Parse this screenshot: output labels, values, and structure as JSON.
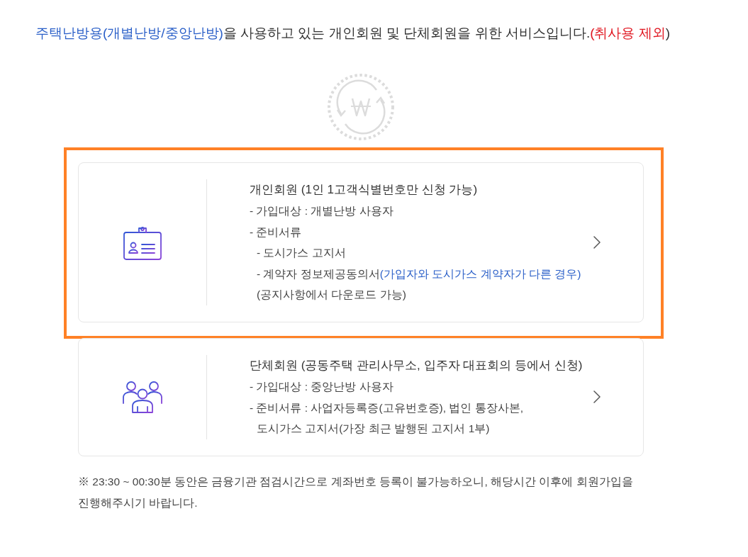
{
  "intro": {
    "segments": [
      {
        "kind": "highlight",
        "text": "주택난방용(개별난방/중앙난방)"
      },
      {
        "kind": "plain",
        "text": "을 사용하고 있는 개인회원 및 단체회원을 위한 서비스입니다."
      },
      {
        "kind": "warning",
        "text": "(취사용 제외"
      },
      {
        "kind": "plain",
        "text": ")"
      }
    ]
  },
  "cards": [
    {
      "kind": "individual",
      "selected": true,
      "title": "개인회원 (1인 1고객식별번호만 신청 가능)",
      "items": [
        {
          "text": "- 가입대상 : 개별난방 사용자"
        },
        {
          "text": "- 준비서류",
          "children": [
            {
              "text": "- 도시가스 고지서"
            },
            {
              "text": "- 계약자 정보제공동의서",
              "note": "(가입자와 도시가스 계약자가 다른 경우)"
            },
            {
              "text": "(공지사항에서 다운로드 가능)"
            }
          ]
        }
      ]
    },
    {
      "kind": "group",
      "selected": false,
      "title": "단체회원 (공동주택 관리사무소, 입주자 대표회의 등에서 신청)",
      "items": [
        {
          "text": "- 가입대상 : 중앙난방 사용자"
        },
        {
          "text": "- 준비서류 : 사업자등록증(고유번호증), 법인 통장사본,",
          "children": [
            {
              "text": "도시가스 고지서(가장 최근 발행된 고지서 1부)"
            }
          ]
        }
      ]
    }
  ],
  "notice": "※ 23:30 ~ 00:30분 동안은 금융기관 점검시간으로 계좌번호 등록이 불가능하오니, 해당시간 이후에 회원가입을 진행해주시기 바랍니다."
}
